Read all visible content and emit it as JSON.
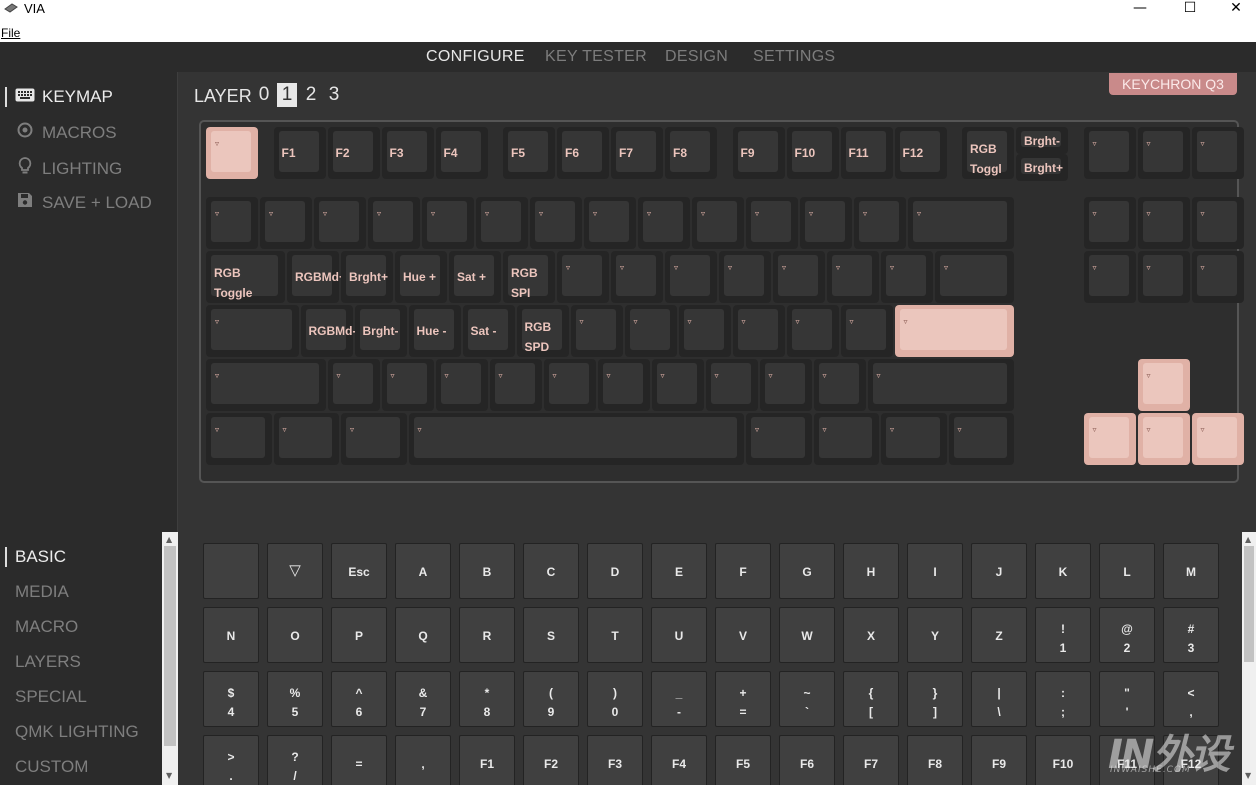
{
  "window": {
    "title": "VIA",
    "menu_file": "File",
    "minimize": "—",
    "maximize": "☐",
    "close": "✕"
  },
  "nav": {
    "tabs": [
      "CONFIGURE",
      "KEY TESTER",
      "DESIGN",
      "SETTINGS"
    ],
    "active": "CONFIGURE"
  },
  "sidebar": {
    "items": [
      {
        "label": "KEYMAP",
        "icon": "keyboard-icon",
        "active": true
      },
      {
        "label": "MACROS",
        "icon": "record-icon",
        "active": false
      },
      {
        "label": "LIGHTING",
        "icon": "lightbulb-icon",
        "active": false
      },
      {
        "label": "SAVE + LOAD",
        "icon": "floppy-disk-icon",
        "active": false
      }
    ]
  },
  "layers": {
    "label": "LAYER",
    "numbers": [
      "0",
      "1",
      "2",
      "3"
    ],
    "active": "1"
  },
  "keyboard_name": "KEYCHRON Q3",
  "keymap": {
    "row0": [
      "▿",
      "F1",
      "F2",
      "F3",
      "F4",
      "F5",
      "F6",
      "F7",
      "F8",
      "F9",
      "F10",
      "F11",
      "F12",
      "RGB\nToggl",
      "Brght-",
      "Brght+",
      "▿",
      "▿",
      "▿"
    ],
    "row1": [
      "▿",
      "▿",
      "▿",
      "▿",
      "▿",
      "▿",
      "▿",
      "▿",
      "▿",
      "▿",
      "▿",
      "▿",
      "▿",
      "▿",
      "▿",
      "▿",
      "▿"
    ],
    "row2": [
      "RGB\nToggle",
      "RGBMd+",
      "Brght+",
      "Hue +",
      "Sat +",
      "RGB\nSPI",
      "▿",
      "▿",
      "▿",
      "▿",
      "▿",
      "▿",
      "▿",
      "▿",
      "▿",
      "▿",
      "▿"
    ],
    "row3": [
      "▿",
      "RGBMd-",
      "Brght-",
      "Hue -",
      "Sat -",
      "RGB\nSPD",
      "▿",
      "▿",
      "▿",
      "▿",
      "▿",
      "▿",
      "▿"
    ],
    "row4": [
      "▿",
      "▿",
      "▿",
      "▿",
      "▿",
      "▿",
      "▿",
      "▿",
      "▿",
      "▿",
      "▿",
      "▿",
      "▿"
    ],
    "row5": [
      "▿",
      "▿",
      "▿",
      "▿",
      "▿",
      "▿",
      "▿",
      "▿",
      "▿",
      "▿",
      "▿"
    ]
  },
  "categories": {
    "items": [
      "BASIC",
      "MEDIA",
      "MACRO",
      "LAYERS",
      "SPECIAL",
      "QMK LIGHTING",
      "CUSTOM"
    ],
    "active": "BASIC"
  },
  "basic_keys": [
    [
      "",
      "▽",
      "Esc",
      "A",
      "B",
      "C",
      "D",
      "E",
      "F",
      "G",
      "H",
      "I",
      "J",
      "K",
      "L",
      "M"
    ],
    [
      "N",
      "O",
      "P",
      "Q",
      "R",
      "S",
      "T",
      "U",
      "V",
      "W",
      "X",
      "Y",
      "Z",
      "!\n1",
      "@\n2",
      "#\n3"
    ],
    [
      "$\n4",
      "%\n5",
      "^\n6",
      "&\n7",
      "*\n8",
      "(\n9",
      ")\n0",
      "_\n-",
      "+\n=",
      "~\n`",
      "{\n[",
      "}\n]",
      "|\n\\",
      ":\n;",
      "\"\n'",
      "<\n,"
    ],
    [
      ">\n.",
      "?\n/",
      "=",
      ",",
      "F1",
      "F2",
      "F3",
      "F4",
      "F5",
      "F6",
      "F7",
      "F8",
      "F9",
      "F10",
      "F11",
      "F12"
    ]
  ],
  "watermark": {
    "text": "IN外设",
    "subtext": "INWAISHE.COM"
  },
  "colors": {
    "accent": "#c98a8a",
    "selected_key": "#ebc6bd",
    "legend": "#ecc5bd"
  }
}
